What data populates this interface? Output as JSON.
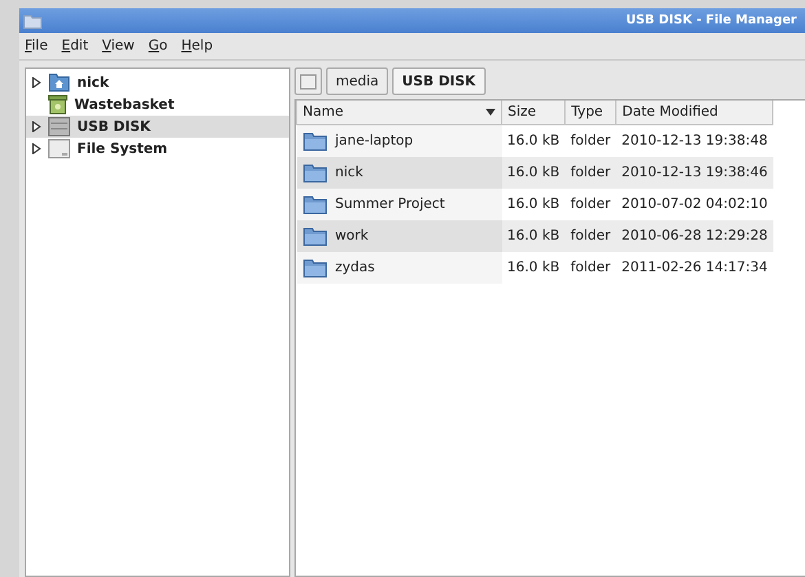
{
  "window": {
    "title": "USB DISK - File Manager"
  },
  "menu": [
    {
      "mnemonic": "F",
      "rest": "ile"
    },
    {
      "mnemonic": "E",
      "rest": "dit"
    },
    {
      "mnemonic": "V",
      "rest": "iew"
    },
    {
      "mnemonic": "G",
      "rest": "o"
    },
    {
      "mnemonic": "H",
      "rest": "elp"
    }
  ],
  "sidebar": {
    "items": [
      {
        "label": "nick",
        "kind": "home",
        "expandable": true,
        "selected": false
      },
      {
        "label": "Wastebasket",
        "kind": "trash",
        "expandable": false,
        "selected": false
      },
      {
        "label": "USB DISK",
        "kind": "drive",
        "expandable": true,
        "selected": true
      },
      {
        "label": "File System",
        "kind": "disk",
        "expandable": true,
        "selected": false
      }
    ]
  },
  "path_bar": [
    {
      "label": "media",
      "selected": false
    },
    {
      "label": "USB DISK",
      "selected": true
    }
  ],
  "table": {
    "columns": [
      {
        "label": "Name",
        "sorted": true
      },
      {
        "label": "Size",
        "sorted": false
      },
      {
        "label": "Type",
        "sorted": false
      },
      {
        "label": "Date Modified",
        "sorted": false
      }
    ],
    "rows": [
      {
        "name": "jane-laptop",
        "size": "16.0 kB",
        "type": "folder",
        "modified": "2010-12-13 19:38:48"
      },
      {
        "name": "nick",
        "size": "16.0 kB",
        "type": "folder",
        "modified": "2010-12-13 19:38:46"
      },
      {
        "name": "Summer Project",
        "size": "16.0 kB",
        "type": "folder",
        "modified": "2010-07-02 04:02:10"
      },
      {
        "name": "work",
        "size": "16.0 kB",
        "type": "folder",
        "modified": "2010-06-28 12:29:28"
      },
      {
        "name": "zydas",
        "size": "16.0 kB",
        "type": "folder",
        "modified": "2011-02-26 14:17:34"
      }
    ]
  }
}
